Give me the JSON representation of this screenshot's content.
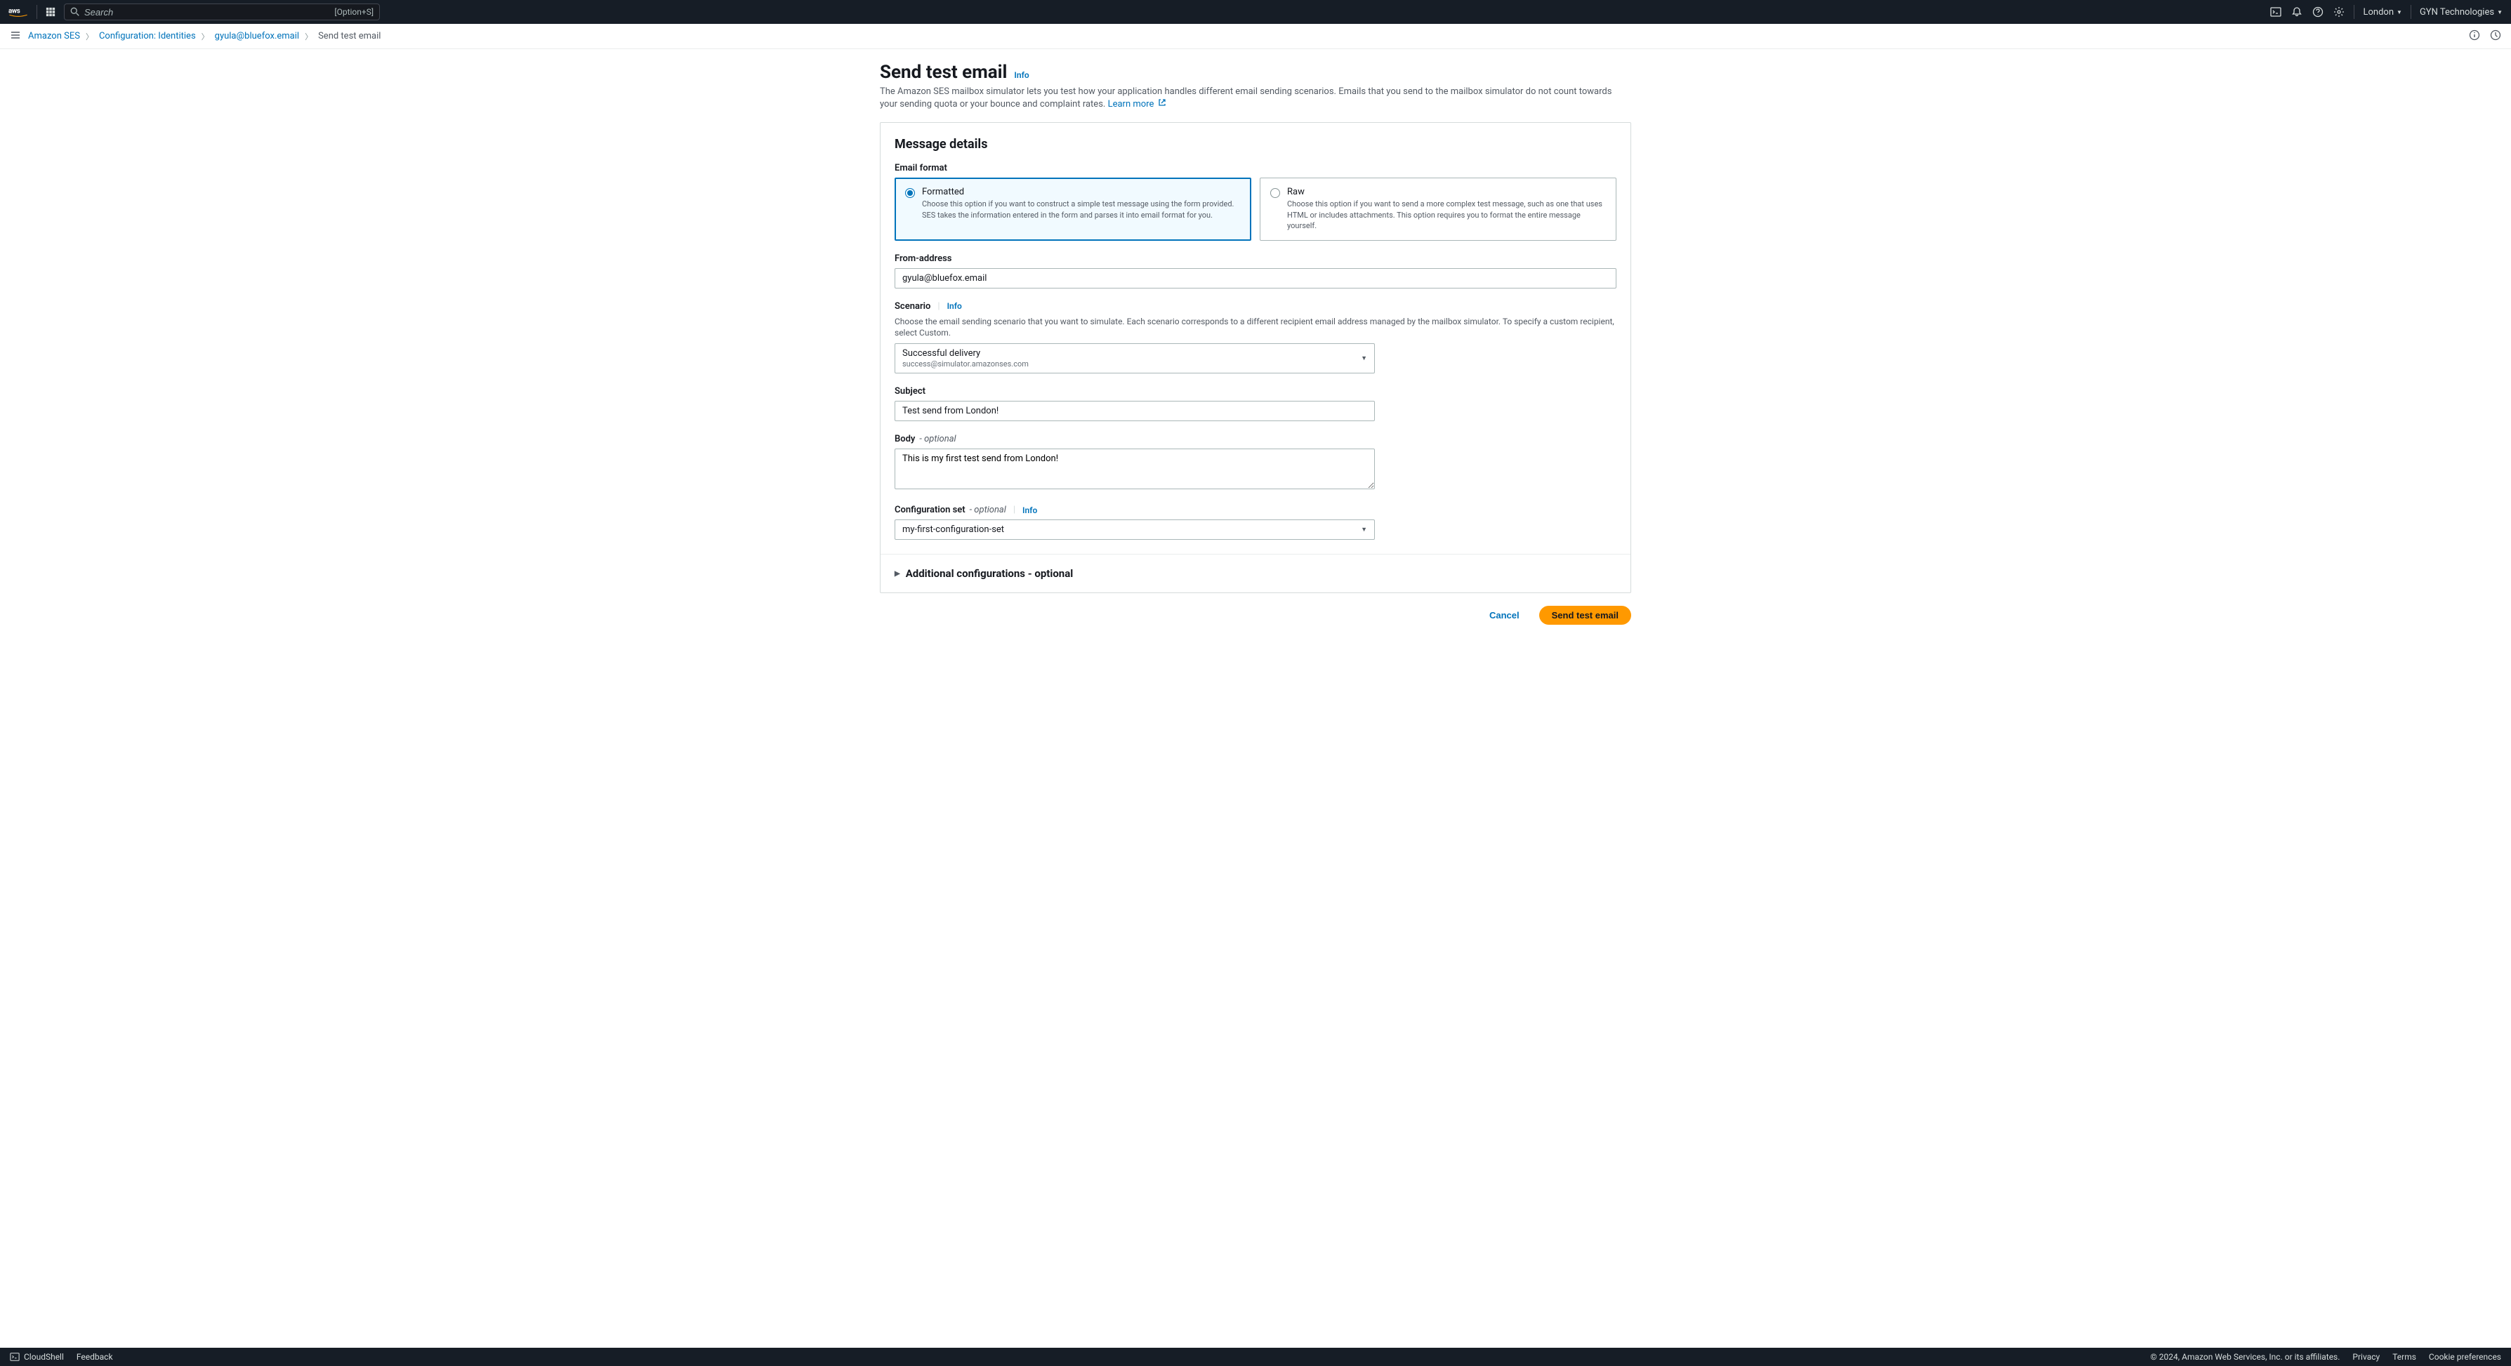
{
  "topNav": {
    "searchPlaceholder": "Search",
    "searchShortcut": "[Option+S]",
    "region": "London",
    "account": "GYN Technologies"
  },
  "breadcrumb": {
    "items": [
      "Amazon SES",
      "Configuration: Identities",
      "gyula@bluefox.email"
    ],
    "current": "Send test email"
  },
  "page": {
    "title": "Send test email",
    "infoLabel": "Info",
    "description": "The Amazon SES mailbox simulator lets you test how your application handles different email sending scenarios. Emails that you send to the mailbox simulator do not count towards your sending quota or your bounce and complaint rates.",
    "learnMore": "Learn more"
  },
  "panel": {
    "title": "Message details",
    "emailFormat": {
      "label": "Email format",
      "formatted": {
        "title": "Formatted",
        "desc": "Choose this option if you want to construct a simple test message using the form provided. SES takes the information entered in the form and parses it into email format for you."
      },
      "raw": {
        "title": "Raw",
        "desc": "Choose this option if you want to send a more complex test message, such as one that uses HTML or includes attachments. This option requires you to format the entire message yourself."
      }
    },
    "fromAddress": {
      "label": "From-address",
      "value": "gyula@bluefox.email"
    },
    "scenario": {
      "label": "Scenario",
      "infoLabel": "Info",
      "desc": "Choose the email sending scenario that you want to simulate. Each scenario corresponds to a different recipient email address managed by the mailbox simulator. To specify a custom recipient, select Custom.",
      "value": "Successful delivery",
      "subvalue": "success@simulator.amazonses.com"
    },
    "subject": {
      "label": "Subject",
      "value": "Test send from London!"
    },
    "body": {
      "label": "Body",
      "optional": "- optional",
      "value": "This is my first test send from London!"
    },
    "configSet": {
      "label": "Configuration set",
      "optional": "- optional",
      "infoLabel": "Info",
      "value": "my-first-configuration-set"
    },
    "additional": "Additional configurations - optional"
  },
  "actions": {
    "cancel": "Cancel",
    "submit": "Send test email"
  },
  "footer": {
    "cloudshell": "CloudShell",
    "feedback": "Feedback",
    "copyright": "© 2024, Amazon Web Services, Inc. or its affiliates.",
    "privacy": "Privacy",
    "terms": "Terms",
    "cookies": "Cookie preferences"
  }
}
